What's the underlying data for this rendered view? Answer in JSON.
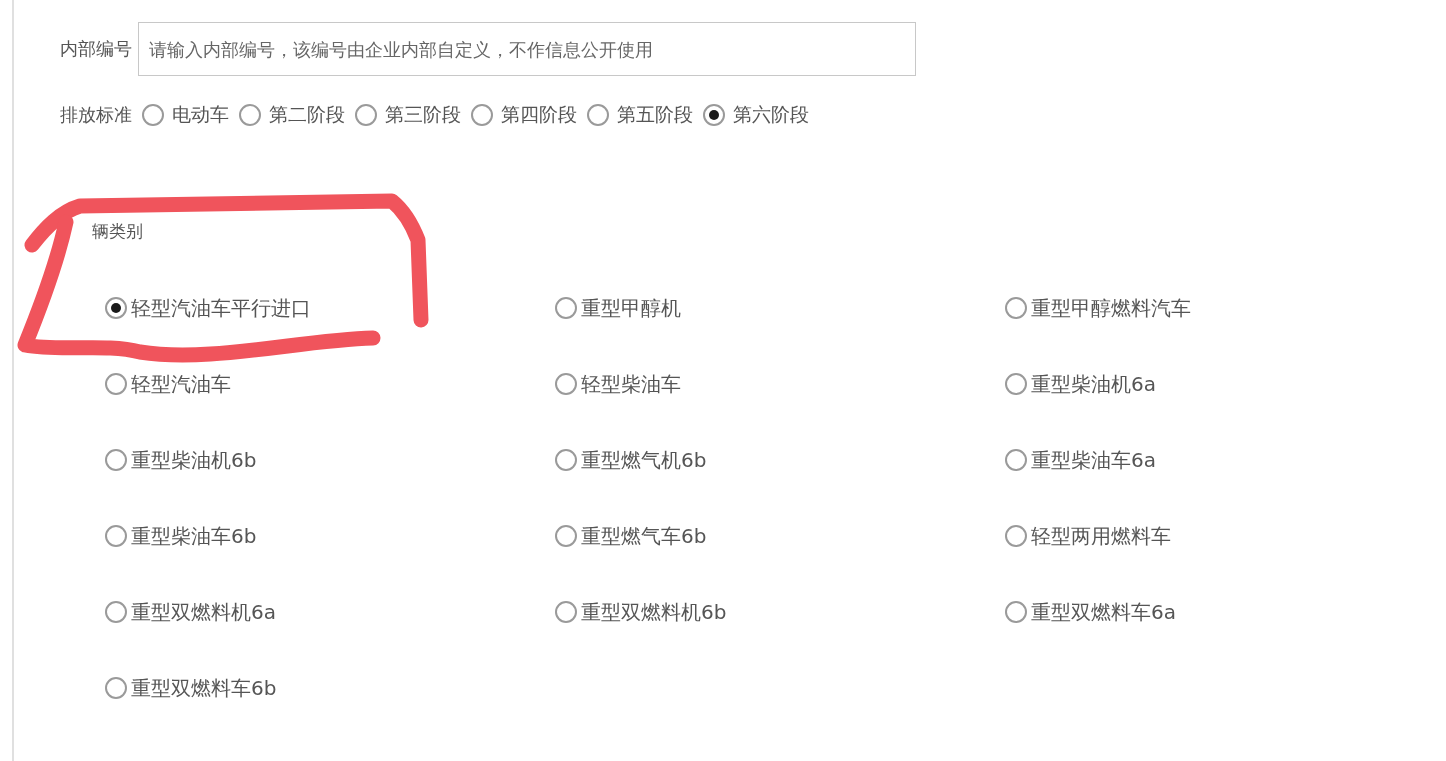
{
  "internal_number": {
    "label": "内部编号",
    "placeholder": "请输入内部编号，该编号由企业内部自定义，不作信息公开使用"
  },
  "emission_standard": {
    "label": "排放标准",
    "options": [
      {
        "label": "电动车",
        "selected": false
      },
      {
        "label": "第二阶段",
        "selected": false
      },
      {
        "label": "第三阶段",
        "selected": false
      },
      {
        "label": "第四阶段",
        "selected": false
      },
      {
        "label": "第五阶段",
        "selected": false
      },
      {
        "label": "第六阶段",
        "selected": true
      }
    ]
  },
  "vehicle_category": {
    "label": "辆类别",
    "options": [
      {
        "label": "轻型汽油车平行进口",
        "selected": true
      },
      {
        "label": "重型甲醇机",
        "selected": false
      },
      {
        "label": "重型甲醇燃料汽车",
        "selected": false
      },
      {
        "label": "轻型汽油车",
        "selected": false
      },
      {
        "label": "轻型柴油车",
        "selected": false
      },
      {
        "label": "重型柴油机6a",
        "selected": false
      },
      {
        "label": "重型柴油机6b",
        "selected": false
      },
      {
        "label": "重型燃气机6b",
        "selected": false
      },
      {
        "label": "重型柴油车6a",
        "selected": false
      },
      {
        "label": "重型柴油车6b",
        "selected": false
      },
      {
        "label": "重型燃气车6b",
        "selected": false
      },
      {
        "label": "轻型两用燃料车",
        "selected": false
      },
      {
        "label": "重型双燃料机6a",
        "selected": false
      },
      {
        "label": "重型双燃料机6b",
        "selected": false
      },
      {
        "label": "重型双燃料车6a",
        "selected": false
      },
      {
        "label": "重型双燃料车6b",
        "selected": false
      }
    ]
  }
}
